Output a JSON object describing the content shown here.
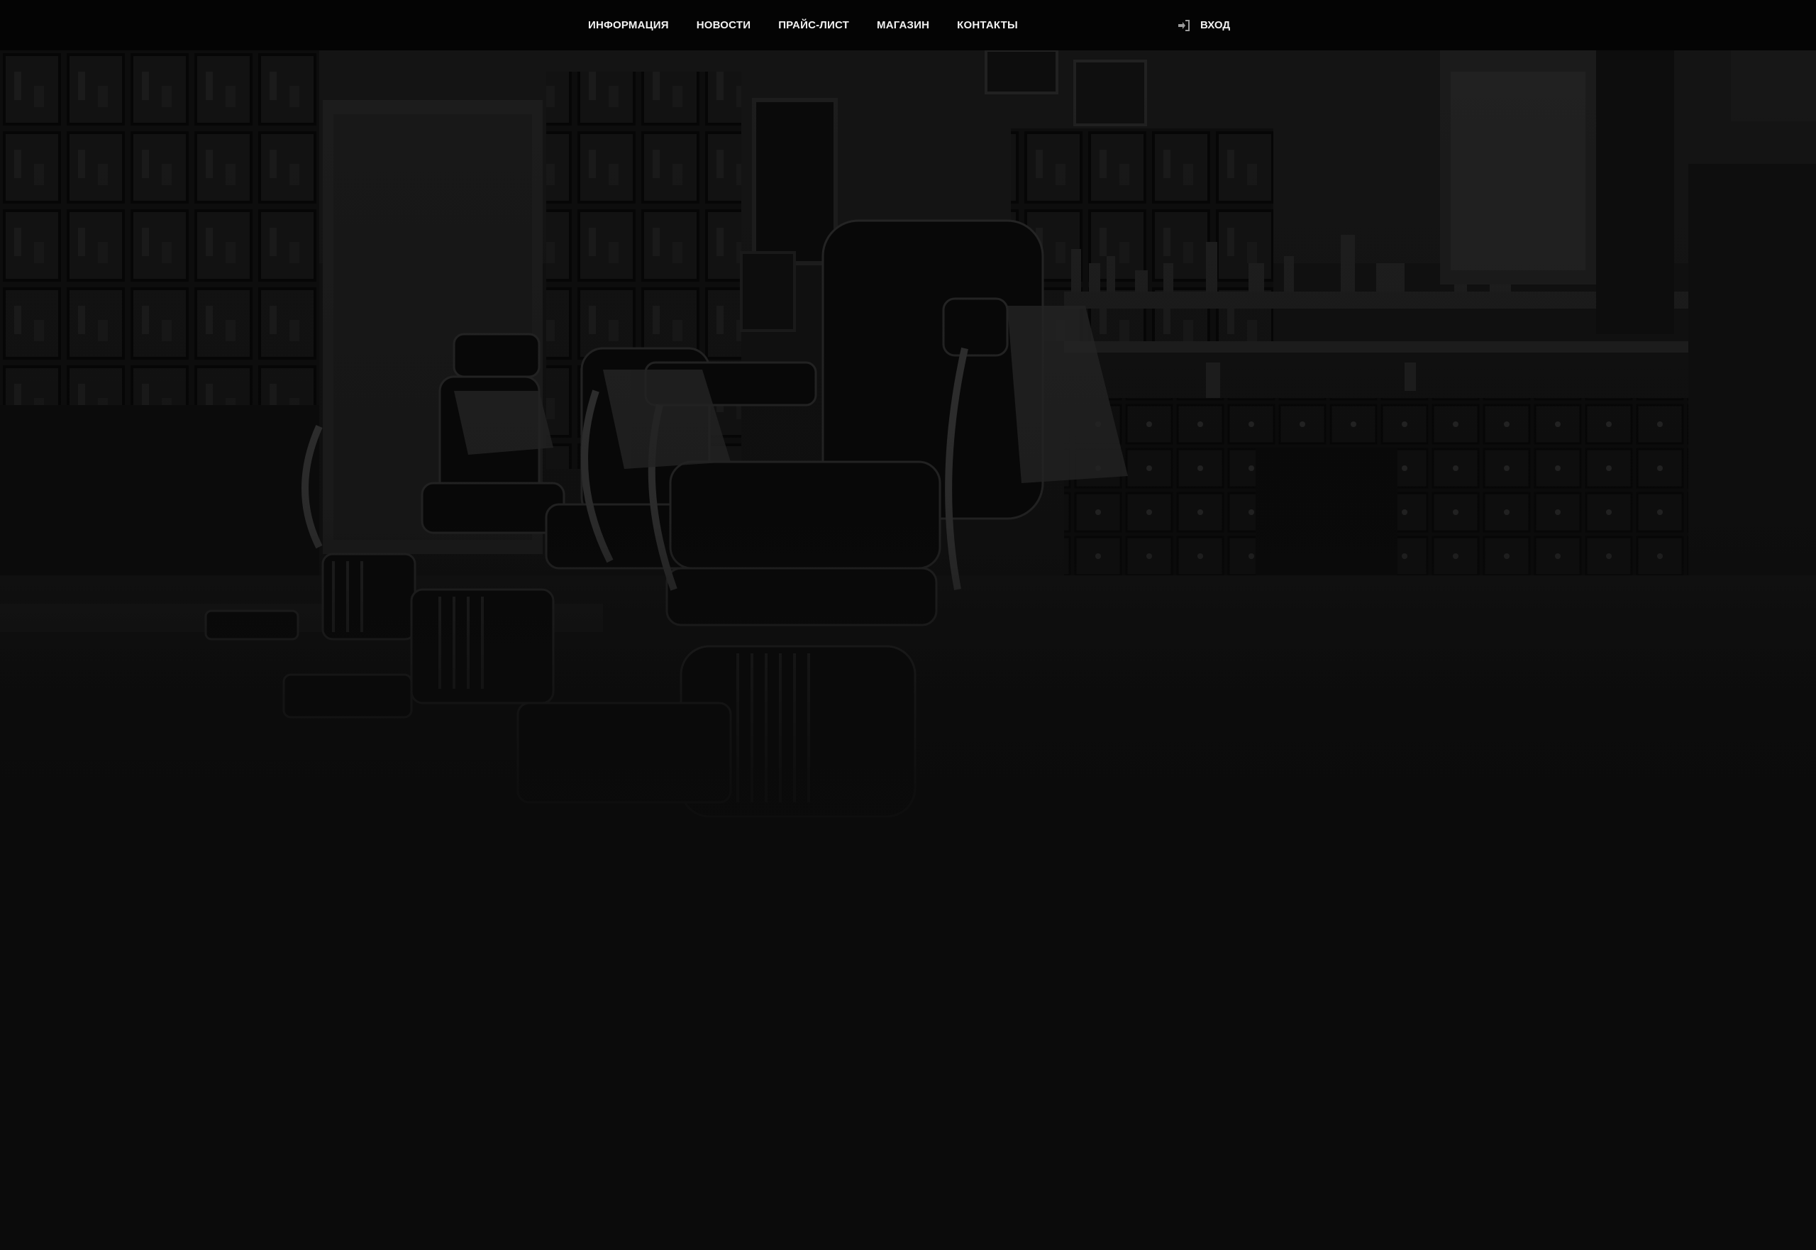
{
  "nav": {
    "items": [
      {
        "label": "ИНФОРМАЦИЯ"
      },
      {
        "label": "НОВОСТИ"
      },
      {
        "label": "ПРАЙС-ЛИСТ"
      },
      {
        "label": "МАГАЗИН"
      },
      {
        "label": "КОНТАКТЫ"
      }
    ],
    "login": {
      "label": "ВХОД",
      "icon": "sign-in-icon"
    }
  },
  "hero": {
    "image": "barbershop-interior-photo"
  },
  "colors": {
    "topbar": "#040404",
    "page": "#0b0b0b",
    "nav_text": "#f2f2f2"
  }
}
